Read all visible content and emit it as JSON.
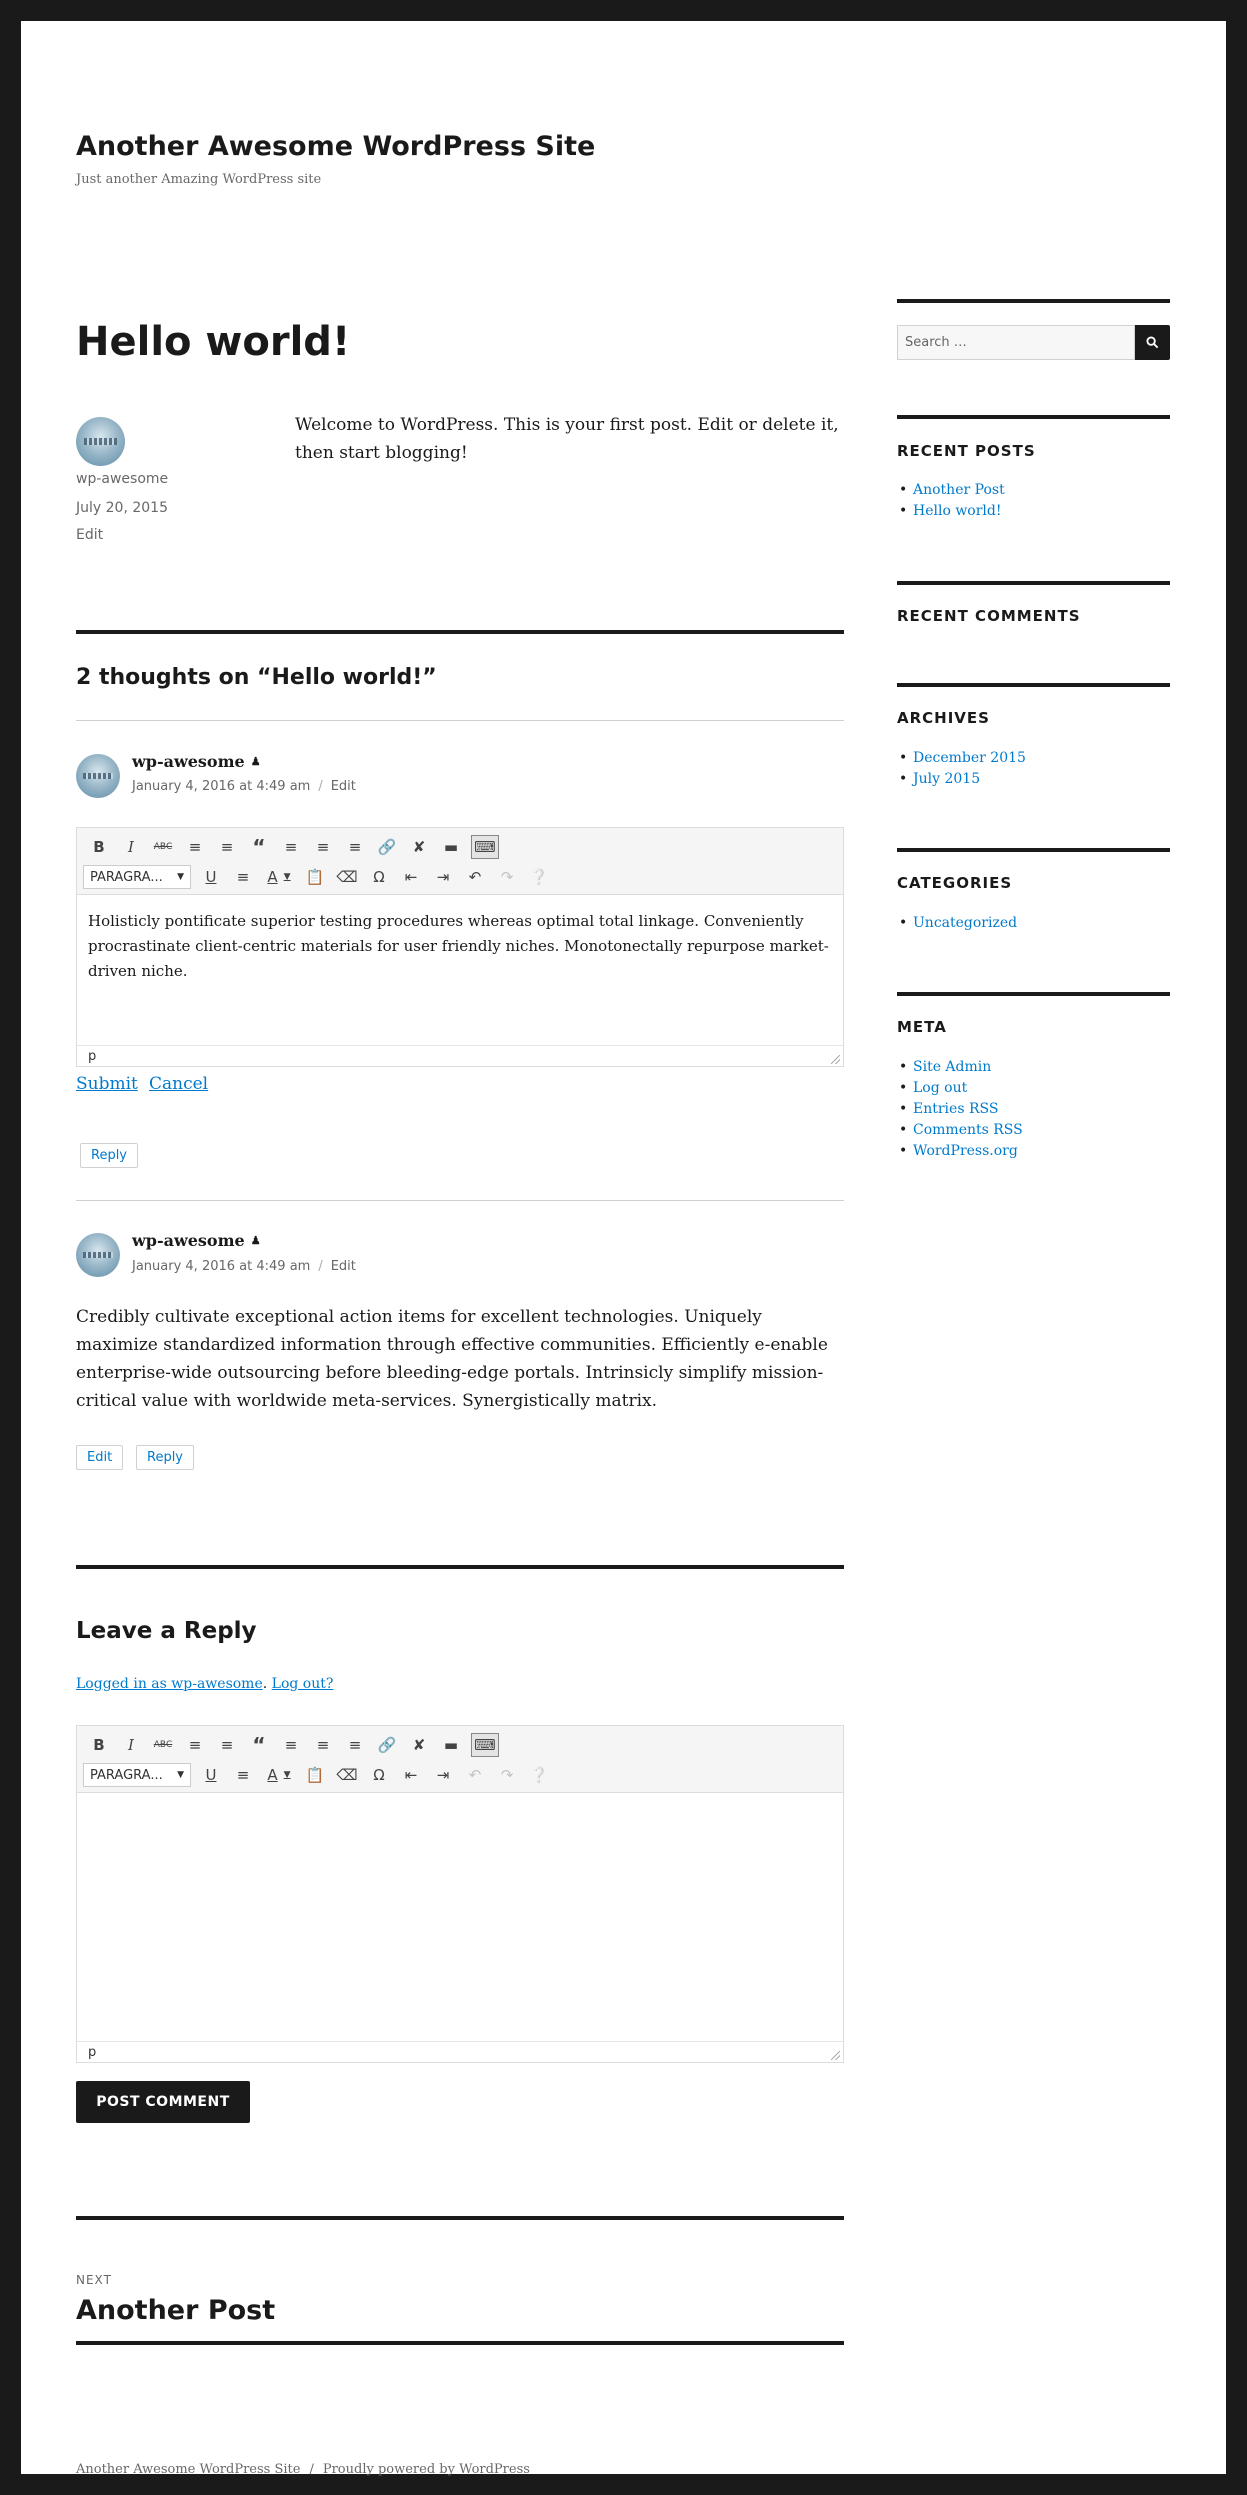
{
  "site": {
    "title": "Another Awesome WordPress Site",
    "description": "Just another Amazing WordPress site"
  },
  "post": {
    "title": "Hello world!",
    "author": "wp-awesome",
    "date": "July 20, 2015",
    "edit_label": "Edit",
    "content": "Welcome to WordPress. This is your first post. Edit or delete it, then start blogging!"
  },
  "comments": {
    "title": "2 thoughts on “Hello world!”",
    "items": [
      {
        "author": "wp-awesome",
        "date": "January 4, 2016 at 4:49 am",
        "edit_label": "Edit",
        "editor_text": "Holisticly pontificate superior testing procedures whereas optimal total linkage. Conveniently procrastinate client-centric materials for user friendly niches. Monotonectally repurpose market-driven niche.",
        "status_path": "p",
        "submit_label": "Submit",
        "cancel_label": "Cancel",
        "reply_label": "Reply"
      },
      {
        "author": "wp-awesome",
        "date": "January 4, 2016 at 4:49 am",
        "edit_label": "Edit",
        "text": "Credibly cultivate exceptional action items for excellent technologies. Uniquely maximize standardized information through effective communities. Efficiently e-enable enterprise-wide outsourcing before bleeding-edge portals. Intrinsicly simplify mission-critical value with worldwide meta-services. Synergistically matrix.",
        "edit_button_label": "Edit",
        "reply_label": "Reply"
      }
    ]
  },
  "editor": {
    "format_select": "PARAGRA...",
    "toolbar_row1": [
      "bold-icon",
      "italic-icon",
      "strikethrough-icon",
      "bullet-list-icon",
      "numbered-list-icon",
      "blockquote-icon",
      "align-left-icon",
      "align-center-icon",
      "align-right-icon",
      "link-icon",
      "unlink-icon",
      "read-more-icon",
      "toolbar-toggle-icon"
    ],
    "toolbar_row2": [
      "underline-icon",
      "justify-icon",
      "text-color-icon",
      "paste-text-icon",
      "clear-format-icon",
      "special-char-icon",
      "outdent-icon",
      "indent-icon",
      "undo-icon",
      "redo-icon",
      "help-icon"
    ]
  },
  "reply_form": {
    "title": "Leave a Reply",
    "logged_in_text": "Logged in as wp-awesome",
    "logout_text": "Log out?",
    "status_path": "p",
    "submit_label": "POST COMMENT"
  },
  "post_nav": {
    "next_label": "NEXT",
    "next_title": "Another Post"
  },
  "sidebar": {
    "search_placeholder": "Search …",
    "recent_posts": {
      "title": "RECENT POSTS",
      "items": [
        "Another Post",
        "Hello world!"
      ]
    },
    "recent_comments": {
      "title": "RECENT COMMENTS"
    },
    "archives": {
      "title": "ARCHIVES",
      "items": [
        "December 2015",
        "July 2015"
      ]
    },
    "categories": {
      "title": "CATEGORIES",
      "items": [
        "Uncategorized"
      ]
    },
    "meta": {
      "title": "META",
      "items": [
        "Site Admin",
        "Log out",
        "Entries RSS",
        "Comments RSS",
        "WordPress.org"
      ]
    }
  },
  "footer": {
    "site_name": "Another Awesome WordPress Site",
    "sep": "/",
    "powered": "Proudly powered by WordPress"
  }
}
